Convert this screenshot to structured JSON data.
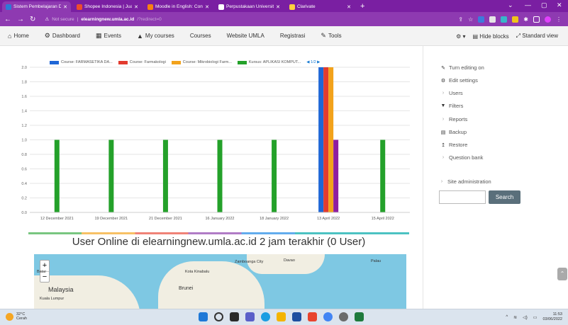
{
  "browser": {
    "tabs": [
      {
        "label": "Sistem Pembelajaran Daring",
        "color": "#2d7ad6",
        "active": true
      },
      {
        "label": "Shopee Indonesia | Jual Beli",
        "color": "#ee4d2d"
      },
      {
        "label": "Moodle in English: Convert",
        "color": "#f98012"
      },
      {
        "label": "Perpustakaan Universitas Ah",
        "color": "#ffffff"
      },
      {
        "label": "Clarivate",
        "color": "#ffcf3e"
      }
    ],
    "url_security": "Not secure",
    "url_host": "elearningnew.umla.ac.id",
    "url_path": "/?redirect=0"
  },
  "nav": {
    "items": [
      {
        "label": "Home",
        "icon": "home-icon",
        "glyph": "🏠"
      },
      {
        "label": "Dashboard",
        "icon": "dashboard-icon",
        "glyph": "⚙"
      },
      {
        "label": "Events",
        "icon": "calendar-icon",
        "glyph": "▦"
      },
      {
        "label": "My courses",
        "icon": "graduation-cap-icon",
        "glyph": "🎓"
      },
      {
        "label": "Courses",
        "icon": "",
        "glyph": ""
      },
      {
        "label": "Website UMLA",
        "icon": "",
        "glyph": ""
      },
      {
        "label": "Registrasi",
        "icon": "",
        "glyph": ""
      },
      {
        "label": "Tools",
        "icon": "wrench-icon",
        "glyph": "🔧"
      }
    ],
    "hide_blocks": "Hide blocks",
    "standard_view": "Standard view"
  },
  "chart_data": {
    "type": "bar",
    "categories": [
      "12 December 2021",
      "19 December 2021",
      "21 December 2021",
      "16 January 2022",
      "18 January 2022",
      "13 April 2022",
      "15 April 2022"
    ],
    "series": [
      {
        "name": "Course: FARMASETIKA DA...",
        "color": "#1e66d6",
        "values": [
          0,
          0,
          0,
          0,
          0,
          2.0,
          0
        ]
      },
      {
        "name": "Course: Farmakologi",
        "color": "#e23b2e",
        "values": [
          0,
          0,
          0,
          0,
          0,
          2.0,
          0
        ]
      },
      {
        "name": "Course: Mikrobiologi Farm...",
        "color": "#f2a21b",
        "values": [
          0,
          0,
          0,
          0,
          0,
          2.0,
          0
        ]
      },
      {
        "name": "Kursus: APLIKASI KOMPUT...",
        "color": "#24a12a",
        "values": [
          1.0,
          1.0,
          1.0,
          1.0,
          1.0,
          0,
          1.0
        ]
      },
      {
        "name": "",
        "color": "#8e1ea0",
        "values": [
          0,
          0,
          0,
          0,
          0,
          1.0,
          0
        ]
      }
    ],
    "legend_page": "1/2",
    "ylim": [
      0,
      2.0
    ],
    "yticks": [
      "0.0",
      "0.2",
      "0.4",
      "0.6",
      "0.8",
      "1.0",
      "1.2",
      "1.4",
      "1.6",
      "1.8",
      "2.0"
    ]
  },
  "online": {
    "heading": "User Online di elearningnew.umla.ac.id 2 jam terakhir (0 User)"
  },
  "map": {
    "labels": [
      "Malaysia",
      "Brunei",
      "Zamboanga City",
      "Davao",
      "Palau",
      "Kota Kinabalu",
      "Kuala Lumpur",
      "Batar"
    ],
    "zoom_in": "+",
    "zoom_out": "−"
  },
  "sidebar": {
    "items": [
      {
        "label": "Turn editing on",
        "glyph": "✎",
        "icon": "pencil-icon"
      },
      {
        "label": "Edit settings",
        "glyph": "⚙",
        "icon": "gear-icon"
      },
      {
        "label": "Users",
        "glyph": "›",
        "icon": "chevron-right-icon"
      },
      {
        "label": "Filters",
        "glyph": "▼",
        "icon": "filter-icon"
      },
      {
        "label": "Reports",
        "glyph": "›",
        "icon": "chevron-right-icon"
      },
      {
        "label": "Backup",
        "glyph": "▤",
        "icon": "backup-icon"
      },
      {
        "label": "Restore",
        "glyph": "↥",
        "icon": "restore-icon"
      },
      {
        "label": "Question bank",
        "glyph": "›",
        "icon": "chevron-right-icon"
      },
      {
        "label": "Site administration",
        "glyph": "›",
        "icon": "chevron-right-icon"
      }
    ],
    "search_label": "Search"
  },
  "taskbar": {
    "temp": "32°C",
    "weather": "Cerah",
    "time": "11:53",
    "date": "03/06/2022"
  }
}
